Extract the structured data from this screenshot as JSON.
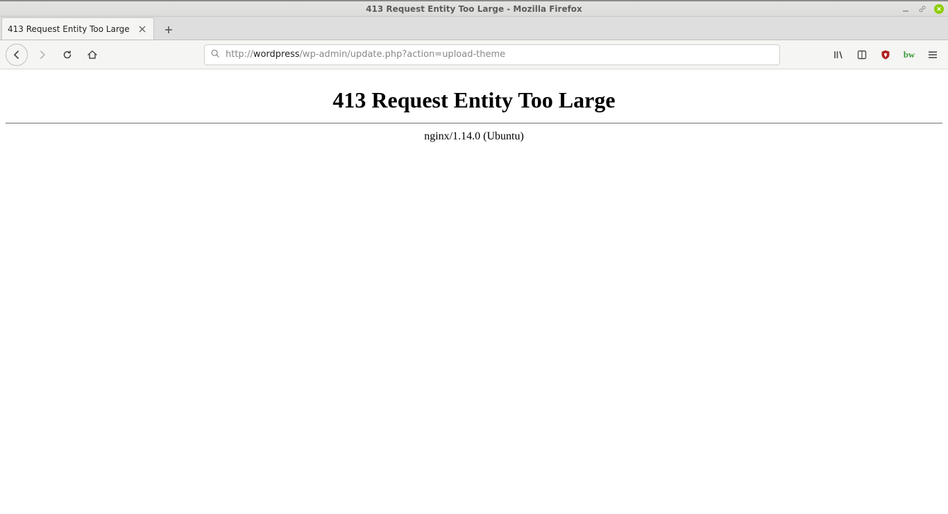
{
  "window": {
    "title": "413 Request Entity Too Large - Mozilla Firefox"
  },
  "tab": {
    "title": "413 Request Entity Too Large"
  },
  "url": {
    "prefix": "http://",
    "host": "wordpress",
    "path": "/wp-admin/update.php?action=upload-theme"
  },
  "page": {
    "heading": "413 Request Entity Too Large",
    "server": "nginx/1.14.0 (Ubuntu)"
  }
}
